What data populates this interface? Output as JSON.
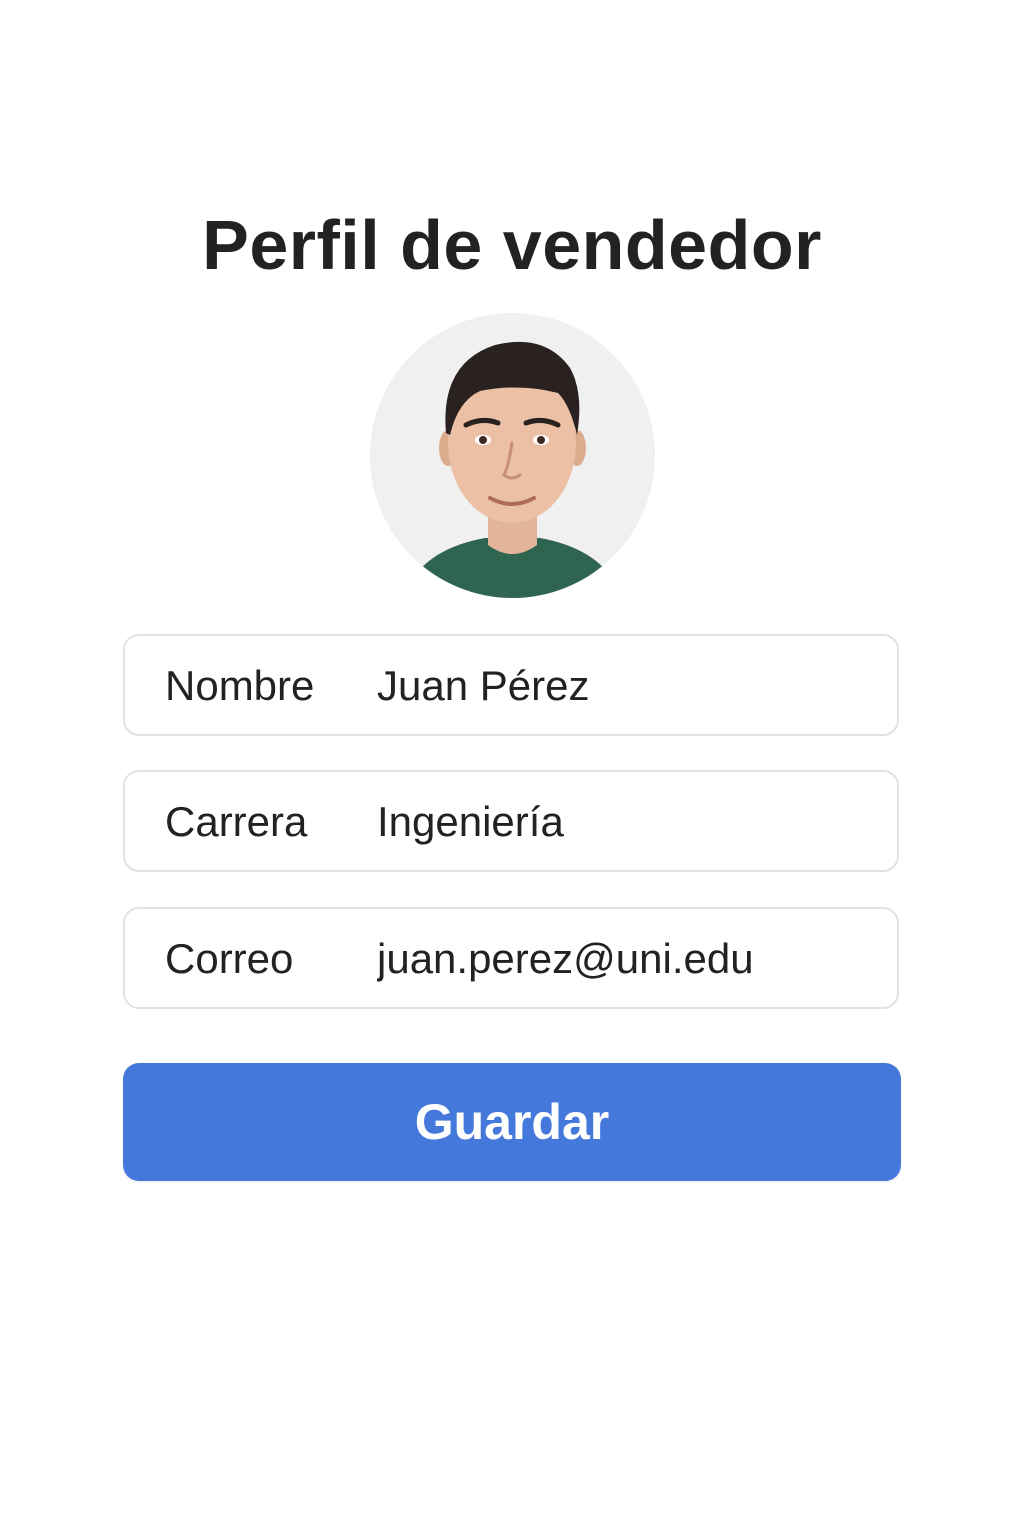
{
  "page": {
    "title": "Perfil de vendedor"
  },
  "avatar": {
    "icon": "profile-photo",
    "shirt_color": "#2f6450",
    "background_color": "#f0f0f0"
  },
  "fields": {
    "nombre": {
      "label": "Nombre",
      "value": "Juan Pérez"
    },
    "carrera": {
      "label": "Carrera",
      "value": "Ingeniería"
    },
    "correo": {
      "label": "Correo",
      "value": "juan.perez@uni.edu"
    }
  },
  "actions": {
    "save_label": "Guardar"
  },
  "colors": {
    "accent": "#4478db",
    "field_border": "#e2e2e2",
    "text": "#222222"
  }
}
